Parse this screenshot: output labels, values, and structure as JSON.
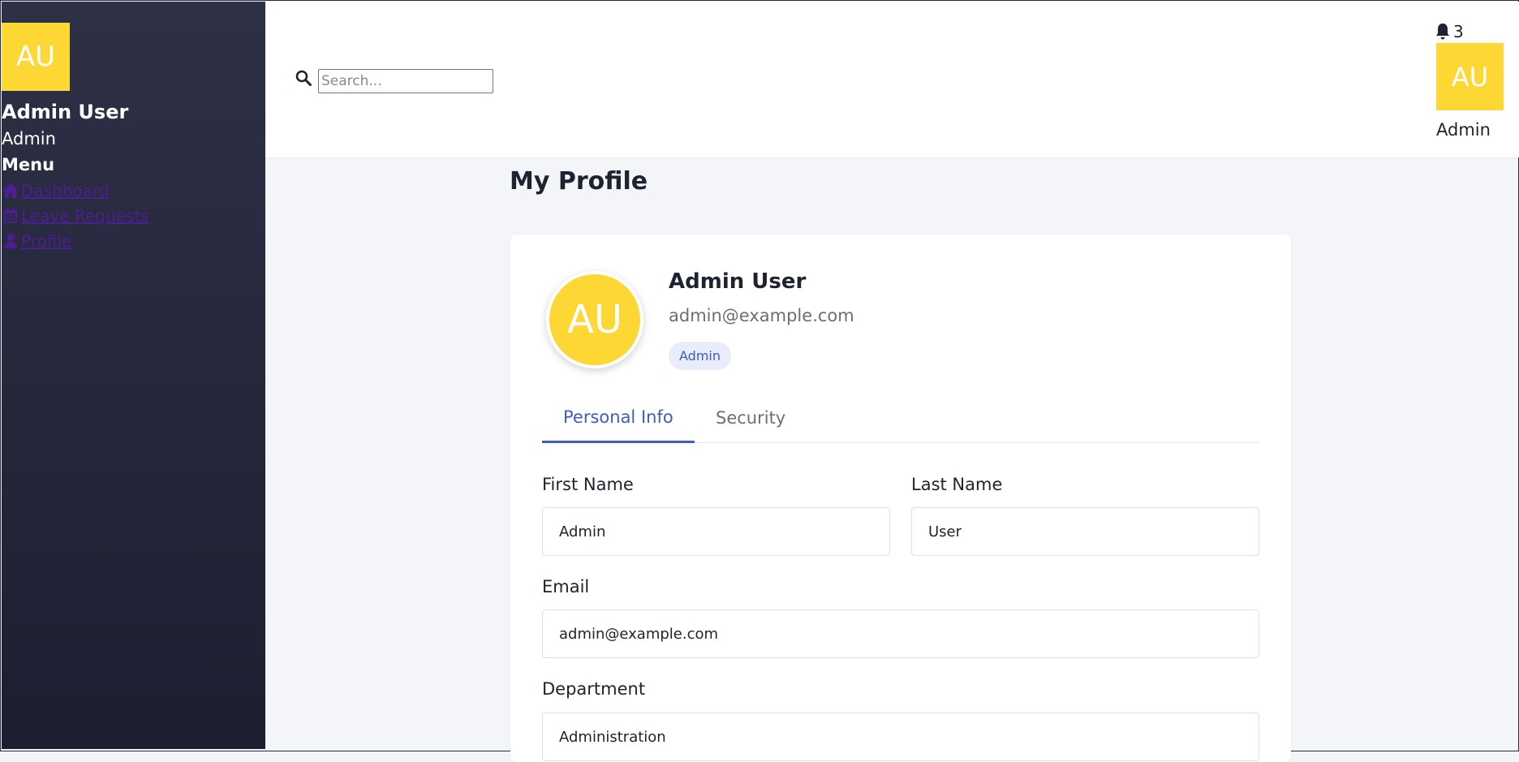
{
  "sidebar": {
    "avatar_initials": "AU",
    "user_name": "Admin User",
    "user_role": "Admin",
    "menu_title": "Menu",
    "items": [
      {
        "label": " Dashboard",
        "icon": "home-icon"
      },
      {
        "label": " Leave Requests",
        "icon": "calendar-icon"
      },
      {
        "label": " Profile",
        "icon": "user-icon"
      }
    ]
  },
  "header": {
    "search_placeholder": "Search...",
    "notification_count": "3",
    "avatar_initials": "AU",
    "user_role": "Admin"
  },
  "main": {
    "page_title": "My Profile",
    "profile": {
      "avatar_initials": "AU",
      "name": "Admin User",
      "email": "admin@example.com",
      "role_badge": "Admin"
    },
    "tabs": [
      {
        "label": "Personal Info",
        "active": true
      },
      {
        "label": "Security",
        "active": false
      }
    ],
    "form": {
      "first_name_label": "First Name",
      "first_name_value": "Admin",
      "last_name_label": "Last Name",
      "last_name_value": "User",
      "email_label": "Email",
      "email_value": "admin@example.com",
      "department_label": "Department",
      "department_value": "Administration"
    }
  },
  "colors": {
    "sidebar_top": "#2e3046",
    "sidebar_bottom": "#1d1f31",
    "avatar_yellow": "#fdd835",
    "accent_blue": "#3f5bc4",
    "link_purple": "#4b1f8f"
  }
}
